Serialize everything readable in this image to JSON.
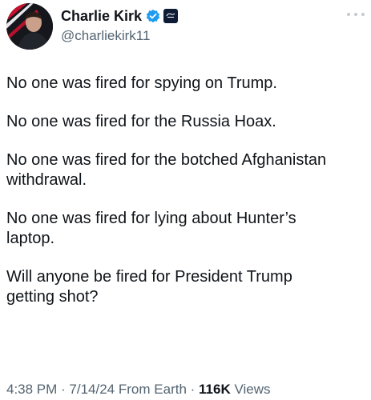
{
  "author": {
    "display_name": "Charlie Kirk",
    "handle": "@charliekirk11",
    "verified_color": "#1d9bf0",
    "avatar_icon": "profile-photo",
    "affiliate_icon": "organization-badge"
  },
  "more_icon": "ellipsis-icon",
  "tweet": {
    "paragraphs": [
      "No one was fired for spying on Trump.",
      "No one was fired for the Russia Hoax.",
      "No one was fired for the botched Afghanistan\nwithdrawal.",
      "No one was fired for lying about Hunter’s\nlaptop.",
      "Will anyone be fired for President Trump\ngetting shot?"
    ]
  },
  "meta": {
    "time": "4:38 PM",
    "separator": " · ",
    "date": "7/14/24",
    "source": "From Earth",
    "views_count": "116K",
    "views_label": "Views"
  },
  "colors": {
    "text": "#0f1419",
    "secondary": "#536471",
    "verified": "#1d9bf0"
  }
}
